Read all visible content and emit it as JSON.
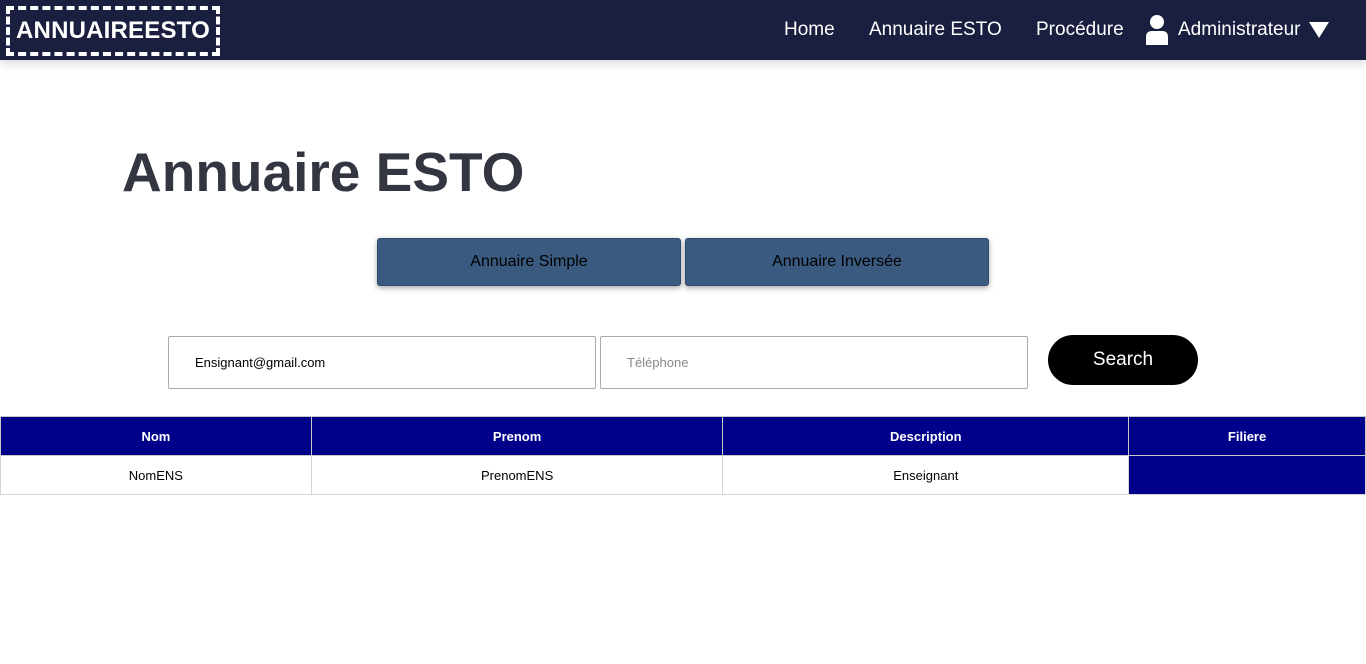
{
  "navbar": {
    "logo": "ANNUAIREESTO",
    "links": [
      "Home",
      "Annuaire ESTO",
      "Procédure"
    ],
    "user_label": "Administrateur",
    "user_icon": "user-icon",
    "caret_icon": "caret-down-icon",
    "background": "#1a1f3f"
  },
  "main": {
    "title": "Annuaire ESTO",
    "tabs": [
      "Annuaire Simple",
      "Annuaire Inversée"
    ],
    "tab_color": "#3a5a80",
    "email_value": "Ensignant@gmail.com",
    "phone_placeholder": "Téléphone",
    "search_label": "Search"
  },
  "table": {
    "header_color": "#00008b",
    "headers": [
      "Nom",
      "Prenom",
      "Description",
      "Filiere"
    ],
    "rows": [
      [
        "NomENS",
        "PrenomENS",
        "Enseignant",
        ""
      ]
    ]
  }
}
